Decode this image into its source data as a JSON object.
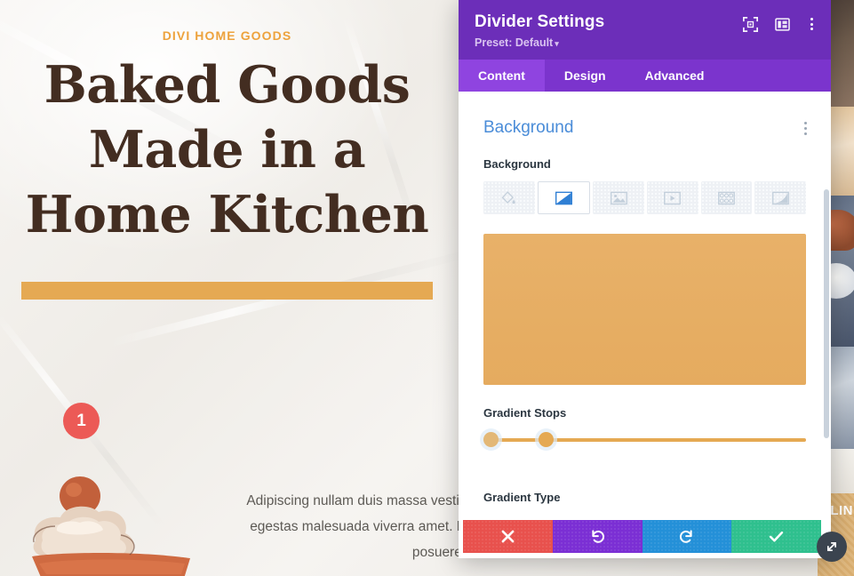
{
  "page": {
    "eyebrow": "DIVI HOME GOODS",
    "heading_line1": "Baked Goods",
    "heading_line2": "Made in a",
    "heading_line3": "Home Kitchen",
    "body_text": "Adipiscing nullam duis massa vestibulum est. Eu, hac nisl, odio egestas malesuada viverra amet. Bibendum diam erat lobortis posuere.",
    "divider_color": "#e5a953",
    "eyebrow_color": "#eda23c",
    "heading_color": "#432d21",
    "photo_strip_label": "ILIN"
  },
  "modal": {
    "title": "Divider Settings",
    "preset_label": "Preset: Default",
    "preset_caret": "▾",
    "header_icons": [
      {
        "name": "focus-target-icon",
        "title": "Focus"
      },
      {
        "name": "layout-panel-icon",
        "title": "Layout"
      },
      {
        "name": "kebab-menu-icon",
        "title": "More options"
      }
    ],
    "tabs": [
      {
        "label": "Content",
        "active": true
      },
      {
        "label": "Design",
        "active": false
      },
      {
        "label": "Advanced",
        "active": false
      }
    ],
    "header_bg": "#6c2eb9",
    "tabbar_bg": "#7b34cd",
    "tab_active_bg": "#8f44e0"
  },
  "content": {
    "section_title": "Background",
    "section_title_color": "#4a8cd8",
    "background_field_label": "Background",
    "background_types": [
      {
        "name": "background-color-tab",
        "icon": "paint-bucket-icon",
        "selected": false
      },
      {
        "name": "background-gradient-tab",
        "icon": "gradient-icon",
        "selected": true
      },
      {
        "name": "background-image-tab",
        "icon": "image-icon",
        "selected": false
      },
      {
        "name": "background-video-tab",
        "icon": "video-play-icon",
        "selected": false
      },
      {
        "name": "background-pattern-tab",
        "icon": "pattern-grid-icon",
        "selected": false
      },
      {
        "name": "background-mask-tab",
        "icon": "mask-shape-icon",
        "selected": false
      }
    ],
    "gradient_preview": {
      "start_color": "#e8b169",
      "end_color": "#e5ab5f"
    },
    "gradient_stops_label": "Gradient Stops",
    "gradient_stops": [
      {
        "name": "gradient-stop-handle-1",
        "position_pct": 0,
        "color": "#e3b877"
      },
      {
        "name": "gradient-stop-handle-2",
        "position_pct": 17,
        "color": "#e5a953"
      }
    ],
    "gradient_track_color": "#e5a953",
    "gradient_type_label": "Gradient Type",
    "step_badge": "1",
    "step_badge_color": "#ec5a56"
  },
  "actions": [
    {
      "name": "cancel-button",
      "icon": "close-x-icon",
      "color": "#e8514d"
    },
    {
      "name": "undo-button",
      "icon": "undo-arrow-icon",
      "color": "#7b2fd4"
    },
    {
      "name": "redo-button",
      "icon": "redo-arrow-icon",
      "color": "#2490d8"
    },
    {
      "name": "save-button",
      "icon": "checkmark-icon",
      "color": "#2fc08e"
    }
  ],
  "resize_handle": {
    "name": "resize-handle",
    "icon": "diagonal-resize-arrows-icon"
  }
}
